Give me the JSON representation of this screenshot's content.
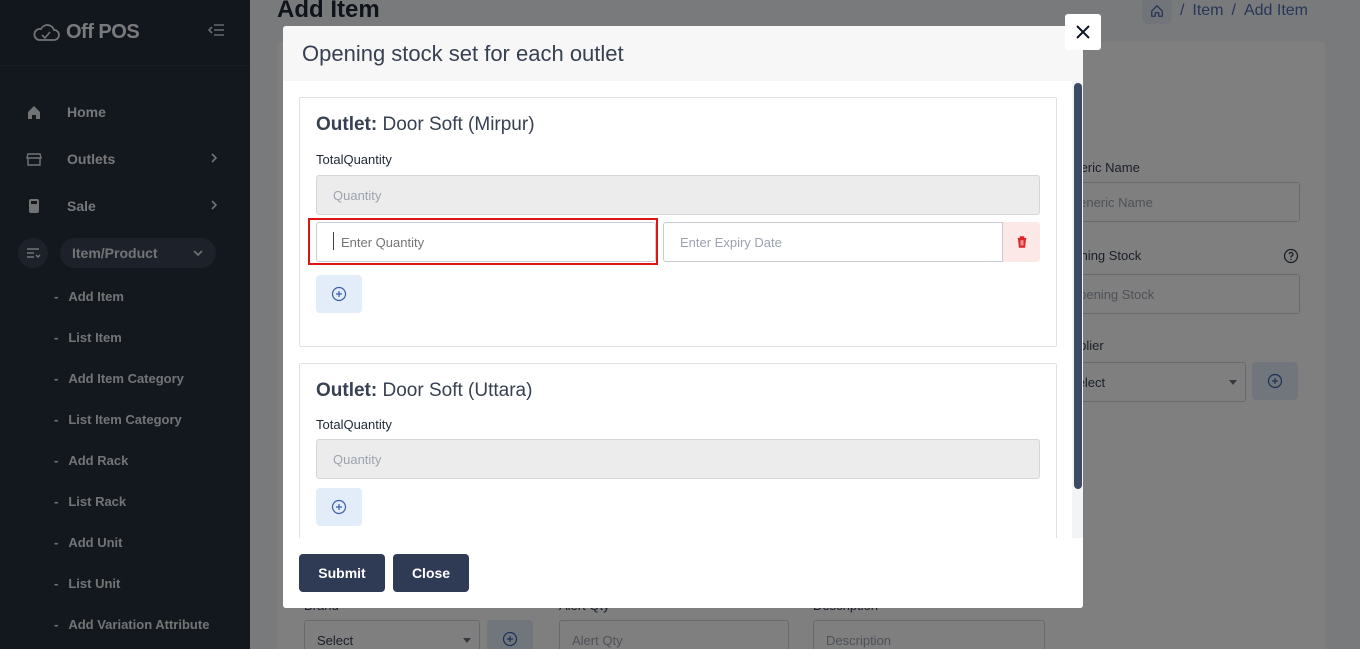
{
  "sidebar": {
    "brand": "Off POS",
    "nav": [
      {
        "label": "Home",
        "icon": "home-icon"
      },
      {
        "label": "Outlets",
        "icon": "store-icon"
      },
      {
        "label": "Sale",
        "icon": "register-icon"
      }
    ],
    "active_section": {
      "label": "Item/Product",
      "icon": "list-icon"
    },
    "sub_items": [
      "Add Item",
      "List Item",
      "Add Item Category",
      "List Item Category",
      "Add Rack",
      "List Rack",
      "Add Unit",
      "List Unit",
      "Add Variation Attribute"
    ],
    "sub_item_prefix": "-"
  },
  "page": {
    "title": "Add Item",
    "breadcrumb": [
      "Item",
      "Add Item"
    ],
    "breadcrumb_separator": "/"
  },
  "form": {
    "generic_name_label": "Generic Name",
    "generic_name_placeholder": "Generic Name",
    "opening_stock_label": "Opening Stock",
    "opening_stock_placeholder": "Opening Stock",
    "supplier_label": "Supplier",
    "supplier_value": "Select",
    "brand_label": "Brand",
    "brand_value": "Select",
    "alert_qty_label": "Alert Qty",
    "alert_qty_placeholder": "Alert Qty",
    "description_label": "Description",
    "description_placeholder": "Description"
  },
  "modal": {
    "title": "Opening stock set for each outlet",
    "outlet_prefix": "Outlet:",
    "outlets": [
      {
        "name": "Door Soft (Mirpur)",
        "total_label": "TotalQuantity",
        "quantity_placeholder": "Quantity",
        "enter_qty_placeholder": "Enter Quantity",
        "expiry_placeholder": "Enter Expiry Date"
      },
      {
        "name": "Door Soft (Uttara)",
        "total_label": "TotalQuantity",
        "quantity_placeholder": "Quantity"
      }
    ],
    "submit_label": "Submit",
    "close_label": "Close"
  },
  "colors": {
    "sidebar_bg": "#27303f",
    "primary_button": "#2f3a55",
    "highlight": "#dc1414",
    "delete": "#e02424",
    "accent": "#4f6fae"
  }
}
